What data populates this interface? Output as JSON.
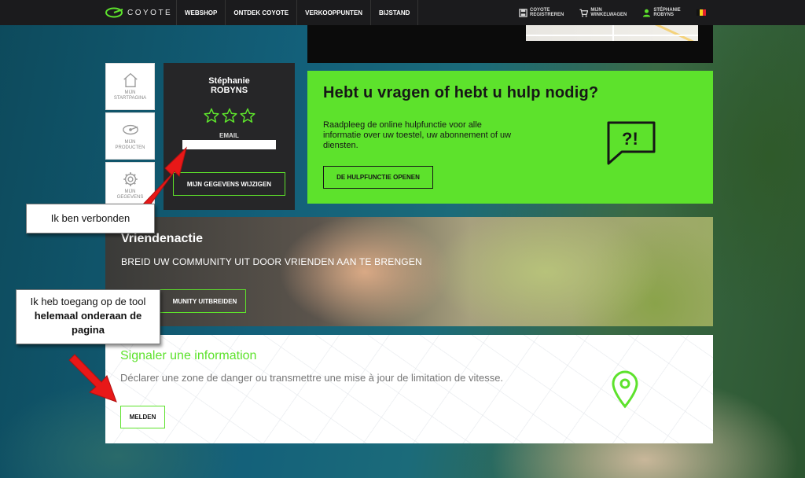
{
  "colors": {
    "accent": "#5de22c",
    "topbar": "#1b1b1d",
    "card": "#262628",
    "arrow": "#e81818"
  },
  "brand": {
    "name": "COYOTE"
  },
  "nav": {
    "items": [
      "WEBSHOP",
      "ONTDEK COYOTE",
      "VERKOOPPUNTEN",
      "BIJSTAND"
    ]
  },
  "account": {
    "register": [
      "COYOTE",
      "REGISTREREN"
    ],
    "cart": [
      "MIJN",
      "WINKELWAGEN"
    ],
    "user": [
      "STÉPHANIE",
      "ROBYNS"
    ],
    "flag": "belgium-flag"
  },
  "sidebar": {
    "items": [
      {
        "icon": "home-icon",
        "label": [
          "MIJN",
          "STARTPAGINA"
        ]
      },
      {
        "icon": "device-icon",
        "label": [
          "MIJN",
          "PRODUCTEN"
        ]
      },
      {
        "icon": "gear-icon",
        "label": [
          "MIJN",
          "GEGEVENS"
        ]
      }
    ]
  },
  "profile": {
    "first_name": "Stéphanie",
    "last_name": "ROBYNS",
    "stars": 0,
    "stars_max": 3,
    "email_label": "EMAIL",
    "email_value": "",
    "edit_button": "MIJN GEGEVENS WIJZIGEN"
  },
  "help": {
    "title": "Hebt u vragen of hebt u hulp nodig?",
    "text": "Raadpleeg de online hulpfunctie voor alle informatie over uw toestel, uw abonnement of uw diensten.",
    "button": "DE HULPFUNCTIE OPENEN",
    "icon": "help-bubble-icon"
  },
  "friends": {
    "title": "Vriendenactie",
    "subtitle": "BREID UW COMMUNITY UIT DOOR VRIENDEN AAN TE BRENGEN",
    "button": "MUNITY UITBREIDEN"
  },
  "signal": {
    "title": "Signaler une information",
    "text": "Déclarer une zone de danger ou transmettre une mise à jour de limitation de vitesse.",
    "button": "MELDEN",
    "icon": "location-pin-icon"
  },
  "annotations": {
    "connected": "Ik ben verbonden",
    "access_pre": "Ik heb toegang op de tool ",
    "access_bold": "helemaal onderaan de pagina"
  }
}
